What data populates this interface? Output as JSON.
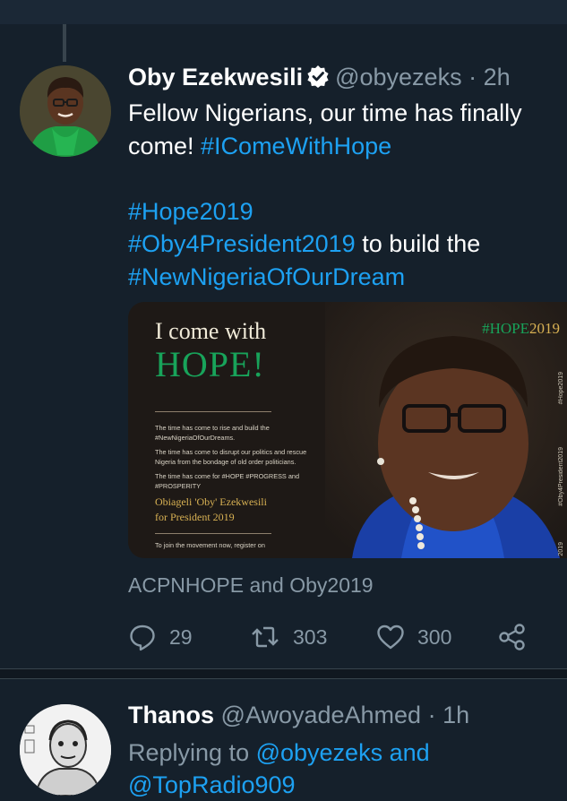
{
  "tweet": {
    "author_name": "Oby Ezekwesili",
    "author_handle": "@obyezeks",
    "separator": "·",
    "time": "2h",
    "verified_icon": "verified-badge-icon",
    "text_line1": "Fellow Nigerians, our time has finally",
    "text_line2_plain": "come! ",
    "hashtag_icomewithhope": "#IComeWithHope",
    "hashtag_hope2019": "#Hope2019",
    "hashtag_oby4president": "#Oby4President2019",
    "text_build": " to build the",
    "hashtag_newnigeria": "#NewNigeriaOfOurDream",
    "media": {
      "title_line1": "I come with",
      "title_line2": "HOPE!",
      "hashtag_corner_prefix": "#",
      "hashtag_corner_green": "HOPE",
      "hashtag_corner_year": "2019",
      "para1": "The time has come to rise and build the #NewNigeriaOfOurDreams.",
      "para2": "The time has come to disrupt our politics and rescue Nigeria from the bondage of old order politicians.",
      "para3": "The time has come for #HOPE #PROGRESS and #PROSPERITY",
      "signature_line1": "Obiageli 'Oby' Ezekwesili",
      "signature_line2": "for President 2019",
      "join_text": "To join the movement now, register on",
      "vertical_tag1": "#Hope2019",
      "vertical_tag2": "#Oby4President2019",
      "vertical_tag3": "2019"
    },
    "attribution": "ACPNHOPE and Oby2019",
    "actions": {
      "reply_count": "29",
      "retweet_count": "303",
      "like_count": "300"
    }
  },
  "reply": {
    "author_name": "Thanos",
    "author_handle": "@AwoyadeAhmed",
    "separator": "·",
    "time": "1h",
    "replying_prefix": "Replying to ",
    "replying_handle1": "@obyezeks",
    "replying_and": " and",
    "replying_handle2": "@TopRadio909"
  },
  "colors": {
    "background": "#15202b",
    "accent": "#1da1f2",
    "muted": "#8899a6",
    "border": "#38444d",
    "hope_green": "#18a35a",
    "gold": "#d8b153"
  }
}
